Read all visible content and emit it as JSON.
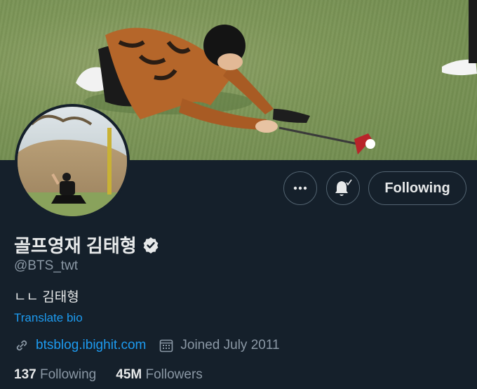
{
  "profile": {
    "display_name": "골프영재 김태형",
    "handle": "@BTS_twt",
    "bio": "ㄴㄴ 김태형",
    "translate_label": "Translate bio",
    "website": "btsblog.ibighit.com",
    "joined": "Joined July 2011",
    "following_count": "137",
    "following_label": "Following",
    "followers_count": "45M",
    "followers_label": "Followers"
  },
  "actions": {
    "following_button": "Following"
  },
  "colors": {
    "background": "#15202b",
    "link": "#1d9bf0",
    "secondary_text": "#8b98a5",
    "border": "#536471"
  },
  "icons": [
    "more-icon",
    "notification-bell-icon",
    "verified-badge-icon",
    "link-icon",
    "calendar-icon"
  ]
}
